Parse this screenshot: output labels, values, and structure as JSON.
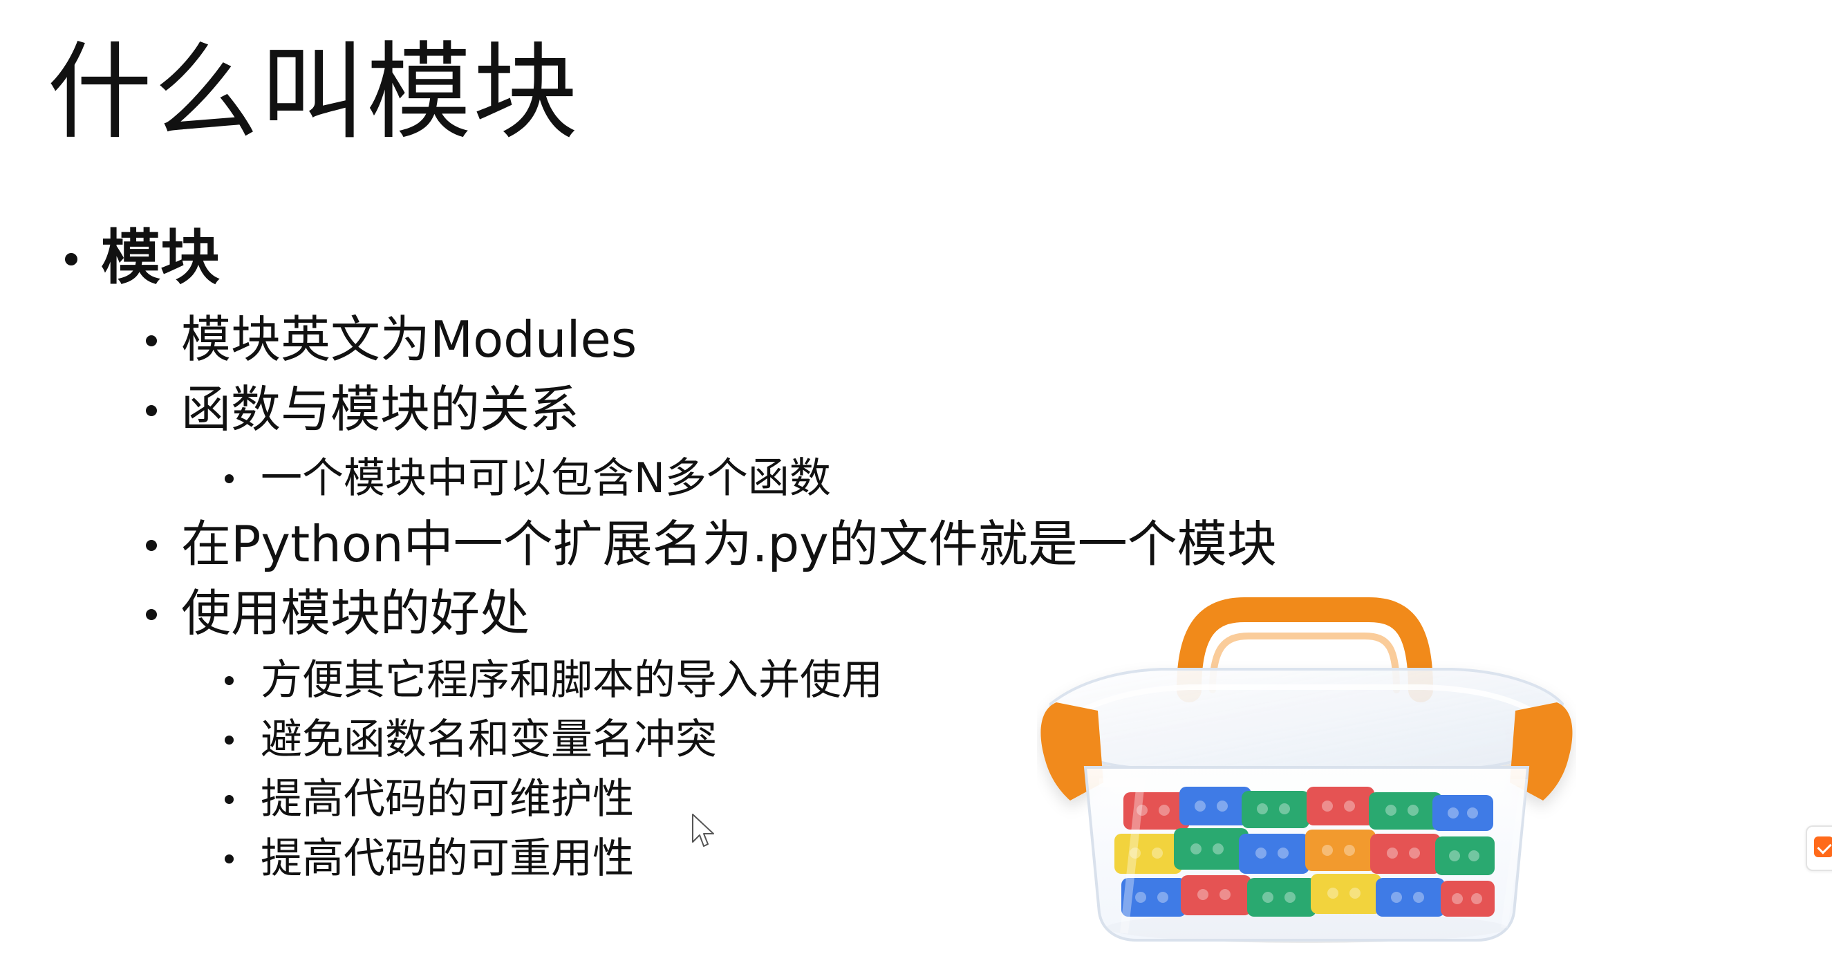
{
  "slide": {
    "title": "什么叫模块",
    "bullets": {
      "root": "模块",
      "modules_english": "模块英文为Modules",
      "function_relation": "函数与模块的关系",
      "module_contains_functions": "一个模块中可以包含N多个函数",
      "python_file_module": "在Python中一个扩展名为.py的文件就是一个模块",
      "benefits": "使用模块的好处",
      "benefit_items": [
        "方便其它程序和脚本的导入并使用",
        "避免函数名和变量名冲突",
        "提高代码的可维护性",
        "提高代码的可重用性"
      ]
    }
  },
  "image": {
    "semantic": "storage-box-with-building-blocks",
    "colors": {
      "handle": "#f18a1a",
      "box": "#eef2f7",
      "blue": "#3f7be6",
      "green": "#2aa970",
      "red": "#e55353",
      "yellow": "#f2d33d",
      "orange": "#f29a2e"
    }
  },
  "ui": {
    "cursor_icon": "mouse-pointer-icon",
    "side_tab_icon": "orange-side-tab-icon"
  }
}
